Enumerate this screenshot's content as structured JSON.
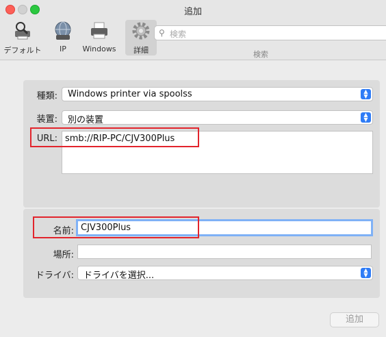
{
  "window": {
    "title": "追加"
  },
  "toolbar": {
    "items": [
      {
        "label": "デフォルト",
        "icon": "default-printer-icon"
      },
      {
        "label": "IP",
        "icon": "globe-icon"
      },
      {
        "label": "Windows",
        "icon": "windows-printer-icon"
      },
      {
        "label": "詳細",
        "icon": "gear-icon"
      }
    ],
    "search": {
      "placeholder": "検索",
      "label": "検索"
    }
  },
  "form": {
    "type_label": "種類:",
    "type_value": "Windows printer via spoolss",
    "device_label": "装置:",
    "device_value": "別の装置",
    "url_label": "URL:",
    "url_value": "smb://RIP-PC/CJV300Plus",
    "name_label": "名前:",
    "name_value": "CJV300Plus",
    "location_label": "場所:",
    "location_value": "",
    "driver_label": "ドライバ:",
    "driver_value": "ドライバを選択..."
  },
  "add_button": "追加",
  "colors": {
    "accent": "#2f7cf6",
    "highlight": "#e2242c",
    "focus_ring": "#7fb1f6"
  }
}
